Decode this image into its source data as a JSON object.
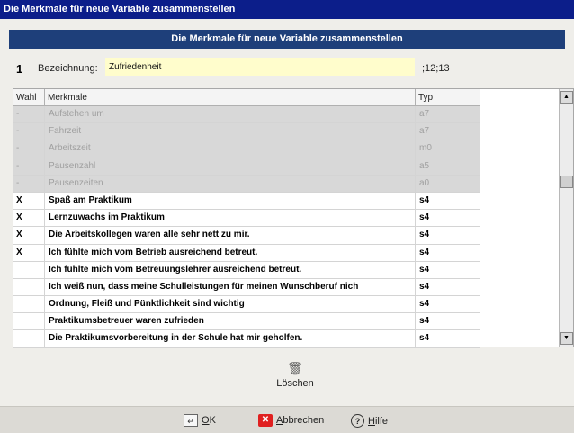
{
  "window": {
    "title": "Die Merkmale für neue Variable zusammenstellen"
  },
  "header": {
    "title": "Die Merkmale für neue Variable zusammenstellen"
  },
  "form": {
    "number": "1",
    "bezeichnung_label": "Bezeichnung:",
    "bezeichnung_value": "Zufriedenheit",
    "suffix": ";12;13"
  },
  "table": {
    "headers": {
      "wahl": "Wahl",
      "merkmale": "Merkmale",
      "typ": "Typ"
    },
    "rows": [
      {
        "wahl": "-",
        "merkmal": "Aufstehen um",
        "typ": "a7",
        "state": "disabled"
      },
      {
        "wahl": "-",
        "merkmal": "Fahrzeit",
        "typ": "a7",
        "state": "disabled"
      },
      {
        "wahl": "-",
        "merkmal": "Arbeitszeit",
        "typ": "m0",
        "state": "disabled"
      },
      {
        "wahl": "-",
        "merkmal": "Pausenzahl",
        "typ": "a5",
        "state": "disabled"
      },
      {
        "wahl": "-",
        "merkmal": "Pausenzeiten",
        "typ": "a0",
        "state": "disabled"
      },
      {
        "wahl": "X",
        "merkmal": "Spaß am Praktikum",
        "typ": "s4",
        "state": "active"
      },
      {
        "wahl": "X",
        "merkmal": "Lernzuwachs im Praktikum",
        "typ": "s4",
        "state": "active"
      },
      {
        "wahl": "X",
        "merkmal": "Die Arbeitskollegen waren alle sehr nett zu mir.",
        "typ": "s4",
        "state": "active"
      },
      {
        "wahl": "X",
        "merkmal": "Ich fühlte mich vom Betrieb ausreichend betreut.",
        "typ": "s4",
        "state": "active"
      },
      {
        "wahl": "",
        "merkmal": "Ich fühlte mich vom Betreuungslehrer ausreichend betreut.",
        "typ": "s4",
        "state": "active"
      },
      {
        "wahl": "",
        "merkmal": "Ich weiß nun, dass meine Schulleistungen für meinen Wunschberuf nich",
        "typ": "s4",
        "state": "active"
      },
      {
        "wahl": "",
        "merkmal": "Ordnung, Fleiß und Pünktlichkeit sind wichtig",
        "typ": "s4",
        "state": "active"
      },
      {
        "wahl": "",
        "merkmal": "Praktikumsbetreuer waren zufrieden",
        "typ": "s4",
        "state": "active"
      },
      {
        "wahl": "",
        "merkmal": "Die Praktikumsvorbereitung in der Schule hat mir geholfen.",
        "typ": "s4",
        "state": "active"
      }
    ]
  },
  "actions": {
    "delete_label": "Löschen",
    "ok_underline": "O",
    "ok_rest": "K",
    "cancel_underline": "A",
    "cancel_rest": "bbrechen",
    "help_underline": "H",
    "help_rest": "ilfe"
  },
  "icons": {
    "ok": "ok-icon",
    "cancel": "cancel-icon",
    "help": "help-icon",
    "delete": "trash-icon"
  }
}
